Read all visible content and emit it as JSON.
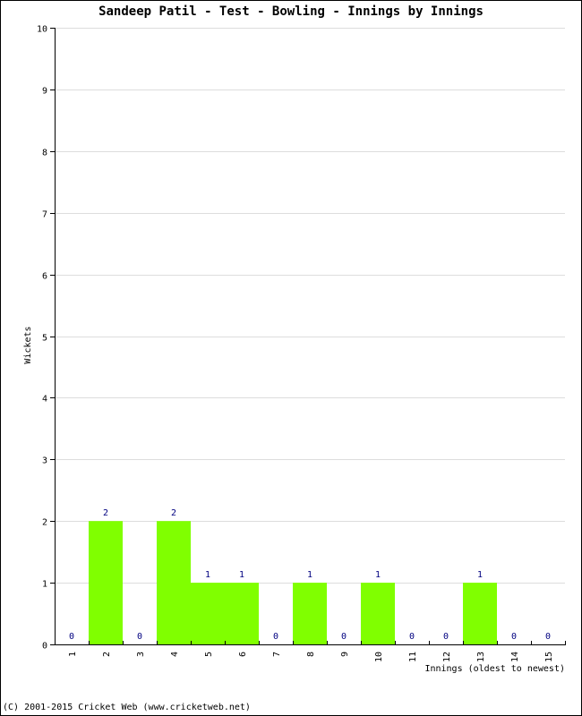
{
  "chart_data": {
    "type": "bar",
    "title": "Sandeep Patil - Test - Bowling - Innings by Innings",
    "xlabel": "Innings (oldest to newest)",
    "ylabel": "Wickets",
    "categories": [
      "1",
      "2",
      "3",
      "4",
      "5",
      "6",
      "7",
      "8",
      "9",
      "10",
      "11",
      "12",
      "13",
      "14",
      "15"
    ],
    "values": [
      0,
      2,
      0,
      2,
      1,
      1,
      0,
      1,
      0,
      1,
      0,
      0,
      1,
      0,
      0
    ],
    "ylim": [
      0,
      10
    ],
    "yticks": [
      "0",
      "1",
      "2",
      "3",
      "4",
      "5",
      "6",
      "7",
      "8",
      "9",
      "10"
    ],
    "grid": true,
    "bar_color": "#80ff00",
    "label_color": "#000080",
    "grid_color": "#dddddd"
  },
  "footer": "(C) 2001-2015 Cricket Web (www.cricketweb.net)"
}
